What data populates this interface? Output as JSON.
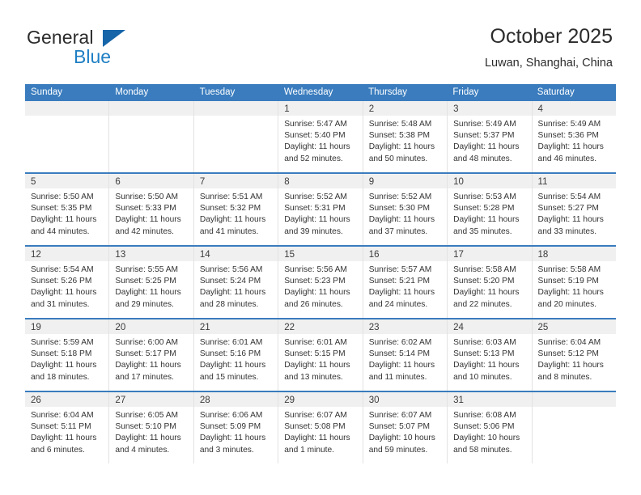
{
  "brand": {
    "name_top": "General",
    "name_bottom": "Blue",
    "accent_color": "#1f7fc4",
    "triangle_color": "#1565a8"
  },
  "header": {
    "title": "October 2025",
    "subtitle": "Luwan, Shanghai, China"
  },
  "theme": {
    "header_row_bg": "#3a7cbe",
    "week_divider": "#3a7cbe",
    "daynum_band_bg": "#f0f0f0",
    "cell_divider": "#e2e2e2",
    "text": "#333333"
  },
  "weekdays": [
    "Sunday",
    "Monday",
    "Tuesday",
    "Wednesday",
    "Thursday",
    "Friday",
    "Saturday"
  ],
  "weeks": [
    [
      {
        "day": "",
        "lines": []
      },
      {
        "day": "",
        "lines": []
      },
      {
        "day": "",
        "lines": []
      },
      {
        "day": "1",
        "lines": [
          "Sunrise: 5:47 AM",
          "Sunset: 5:40 PM",
          "Daylight: 11 hours",
          "and 52 minutes."
        ]
      },
      {
        "day": "2",
        "lines": [
          "Sunrise: 5:48 AM",
          "Sunset: 5:38 PM",
          "Daylight: 11 hours",
          "and 50 minutes."
        ]
      },
      {
        "day": "3",
        "lines": [
          "Sunrise: 5:49 AM",
          "Sunset: 5:37 PM",
          "Daylight: 11 hours",
          "and 48 minutes."
        ]
      },
      {
        "day": "4",
        "lines": [
          "Sunrise: 5:49 AM",
          "Sunset: 5:36 PM",
          "Daylight: 11 hours",
          "and 46 minutes."
        ]
      }
    ],
    [
      {
        "day": "5",
        "lines": [
          "Sunrise: 5:50 AM",
          "Sunset: 5:35 PM",
          "Daylight: 11 hours",
          "and 44 minutes."
        ]
      },
      {
        "day": "6",
        "lines": [
          "Sunrise: 5:50 AM",
          "Sunset: 5:33 PM",
          "Daylight: 11 hours",
          "and 42 minutes."
        ]
      },
      {
        "day": "7",
        "lines": [
          "Sunrise: 5:51 AM",
          "Sunset: 5:32 PM",
          "Daylight: 11 hours",
          "and 41 minutes."
        ]
      },
      {
        "day": "8",
        "lines": [
          "Sunrise: 5:52 AM",
          "Sunset: 5:31 PM",
          "Daylight: 11 hours",
          "and 39 minutes."
        ]
      },
      {
        "day": "9",
        "lines": [
          "Sunrise: 5:52 AM",
          "Sunset: 5:30 PM",
          "Daylight: 11 hours",
          "and 37 minutes."
        ]
      },
      {
        "day": "10",
        "lines": [
          "Sunrise: 5:53 AM",
          "Sunset: 5:28 PM",
          "Daylight: 11 hours",
          "and 35 minutes."
        ]
      },
      {
        "day": "11",
        "lines": [
          "Sunrise: 5:54 AM",
          "Sunset: 5:27 PM",
          "Daylight: 11 hours",
          "and 33 minutes."
        ]
      }
    ],
    [
      {
        "day": "12",
        "lines": [
          "Sunrise: 5:54 AM",
          "Sunset: 5:26 PM",
          "Daylight: 11 hours",
          "and 31 minutes."
        ]
      },
      {
        "day": "13",
        "lines": [
          "Sunrise: 5:55 AM",
          "Sunset: 5:25 PM",
          "Daylight: 11 hours",
          "and 29 minutes."
        ]
      },
      {
        "day": "14",
        "lines": [
          "Sunrise: 5:56 AM",
          "Sunset: 5:24 PM",
          "Daylight: 11 hours",
          "and 28 minutes."
        ]
      },
      {
        "day": "15",
        "lines": [
          "Sunrise: 5:56 AM",
          "Sunset: 5:23 PM",
          "Daylight: 11 hours",
          "and 26 minutes."
        ]
      },
      {
        "day": "16",
        "lines": [
          "Sunrise: 5:57 AM",
          "Sunset: 5:21 PM",
          "Daylight: 11 hours",
          "and 24 minutes."
        ]
      },
      {
        "day": "17",
        "lines": [
          "Sunrise: 5:58 AM",
          "Sunset: 5:20 PM",
          "Daylight: 11 hours",
          "and 22 minutes."
        ]
      },
      {
        "day": "18",
        "lines": [
          "Sunrise: 5:58 AM",
          "Sunset: 5:19 PM",
          "Daylight: 11 hours",
          "and 20 minutes."
        ]
      }
    ],
    [
      {
        "day": "19",
        "lines": [
          "Sunrise: 5:59 AM",
          "Sunset: 5:18 PM",
          "Daylight: 11 hours",
          "and 18 minutes."
        ]
      },
      {
        "day": "20",
        "lines": [
          "Sunrise: 6:00 AM",
          "Sunset: 5:17 PM",
          "Daylight: 11 hours",
          "and 17 minutes."
        ]
      },
      {
        "day": "21",
        "lines": [
          "Sunrise: 6:01 AM",
          "Sunset: 5:16 PM",
          "Daylight: 11 hours",
          "and 15 minutes."
        ]
      },
      {
        "day": "22",
        "lines": [
          "Sunrise: 6:01 AM",
          "Sunset: 5:15 PM",
          "Daylight: 11 hours",
          "and 13 minutes."
        ]
      },
      {
        "day": "23",
        "lines": [
          "Sunrise: 6:02 AM",
          "Sunset: 5:14 PM",
          "Daylight: 11 hours",
          "and 11 minutes."
        ]
      },
      {
        "day": "24",
        "lines": [
          "Sunrise: 6:03 AM",
          "Sunset: 5:13 PM",
          "Daylight: 11 hours",
          "and 10 minutes."
        ]
      },
      {
        "day": "25",
        "lines": [
          "Sunrise: 6:04 AM",
          "Sunset: 5:12 PM",
          "Daylight: 11 hours",
          "and 8 minutes."
        ]
      }
    ],
    [
      {
        "day": "26",
        "lines": [
          "Sunrise: 6:04 AM",
          "Sunset: 5:11 PM",
          "Daylight: 11 hours",
          "and 6 minutes."
        ]
      },
      {
        "day": "27",
        "lines": [
          "Sunrise: 6:05 AM",
          "Sunset: 5:10 PM",
          "Daylight: 11 hours",
          "and 4 minutes."
        ]
      },
      {
        "day": "28",
        "lines": [
          "Sunrise: 6:06 AM",
          "Sunset: 5:09 PM",
          "Daylight: 11 hours",
          "and 3 minutes."
        ]
      },
      {
        "day": "29",
        "lines": [
          "Sunrise: 6:07 AM",
          "Sunset: 5:08 PM",
          "Daylight: 11 hours",
          "and 1 minute."
        ]
      },
      {
        "day": "30",
        "lines": [
          "Sunrise: 6:07 AM",
          "Sunset: 5:07 PM",
          "Daylight: 10 hours",
          "and 59 minutes."
        ]
      },
      {
        "day": "31",
        "lines": [
          "Sunrise: 6:08 AM",
          "Sunset: 5:06 PM",
          "Daylight: 10 hours",
          "and 58 minutes."
        ]
      },
      {
        "day": "",
        "lines": []
      }
    ]
  ]
}
